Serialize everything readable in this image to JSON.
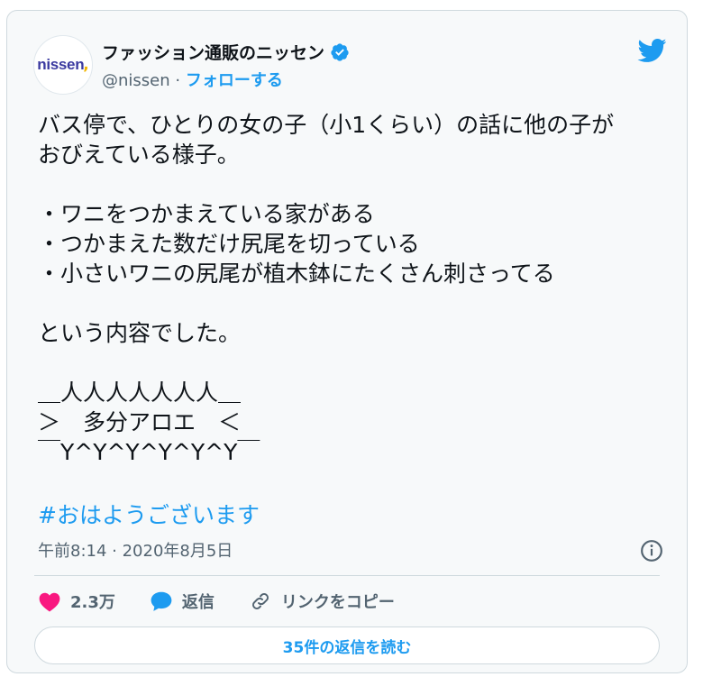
{
  "account": {
    "avatar_logo": "nissen",
    "avatar_dot": ",",
    "display_name": "ファッション通販のニッセン",
    "handle": "@nissen",
    "separator": " · ",
    "follow_label": "フォローする"
  },
  "tweet": {
    "lines": [
      "バス停で、ひとりの女の子（小1くらい）の話に他の子が",
      "おびえている様子。",
      "",
      "・ワニをつかまえている家がある",
      "・つかまえた数だけ尻尾を切っている",
      "・小さいワニの尻尾が植木鉢にたくさん刺さってる",
      "",
      "という内容でした。",
      "",
      "＿人人人人人人人＿",
      "＞　多分アロエ　＜",
      "￣Y^Y^Y^Y^Y^Y￣"
    ],
    "hashtag": "#おはようございます",
    "timestamp": "午前8:14 · 2020年8月5日"
  },
  "actions": {
    "like_count": "2.3万",
    "reply_label": "返信",
    "copy_link_label": "リンクをコピー"
  },
  "read_replies_label": "35件の返信を読む",
  "colors": {
    "accent": "#1d9bf0",
    "like": "#f91880",
    "text": "#0f1419",
    "secondary": "#536471"
  },
  "icons": [
    "verified-badge-icon",
    "twitter-bird-icon",
    "info-icon",
    "heart-icon",
    "reply-bubble-icon",
    "link-icon"
  ]
}
